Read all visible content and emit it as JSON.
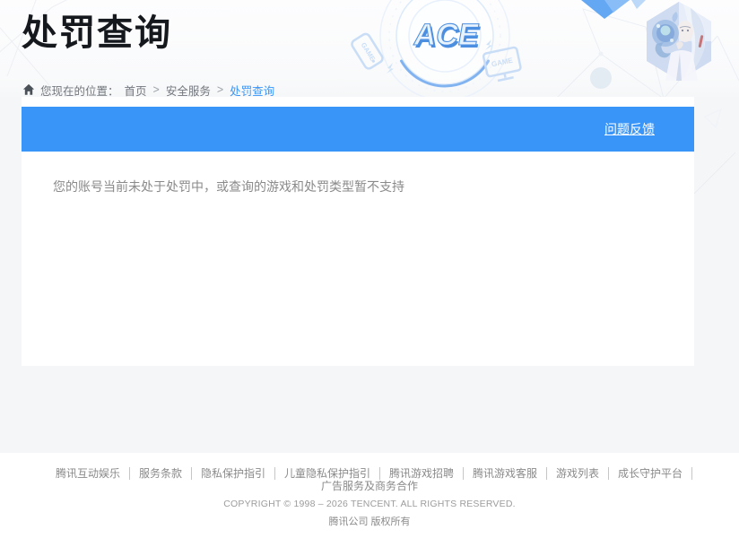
{
  "page_title": "处罚查询",
  "breadcrumb": {
    "label": "您现在的位置：",
    "separator": ">",
    "items": [
      {
        "label": "首页"
      },
      {
        "label": "安全服务"
      },
      {
        "label": "处罚查询"
      }
    ]
  },
  "header_art": {
    "logo_text": "ACE",
    "game_label_phone": "GAME",
    "game_label_monitor": "GAME"
  },
  "banner": {
    "feedback_link": "问题反馈"
  },
  "result": {
    "message": "您的账号当前未处于处罚中，或查询的游戏和处罚类型暂不支持"
  },
  "footer": {
    "links": [
      {
        "label": "腾讯互动娱乐"
      },
      {
        "label": "服务条款"
      },
      {
        "label": "隐私保护指引"
      },
      {
        "label": "儿童隐私保护指引"
      },
      {
        "label": "腾讯游戏招聘"
      },
      {
        "label": "腾讯游戏客服"
      },
      {
        "label": "游戏列表"
      },
      {
        "label": "成长守护平台"
      },
      {
        "label": "广告服务及商务合作"
      }
    ],
    "copyright": "COPYRIGHT © 1998 – 2026 TENCENT. ALL RIGHTS RESERVED.",
    "company": "腾讯公司 版权所有"
  },
  "colors": {
    "banner_blue": "#3996f8",
    "link_blue": "#3a96f8",
    "page_bg": "#f5f6f7",
    "logo_blue": "#4c8fe0",
    "title_color": "#15181d",
    "body_text_gray": "#8a8a8a"
  }
}
